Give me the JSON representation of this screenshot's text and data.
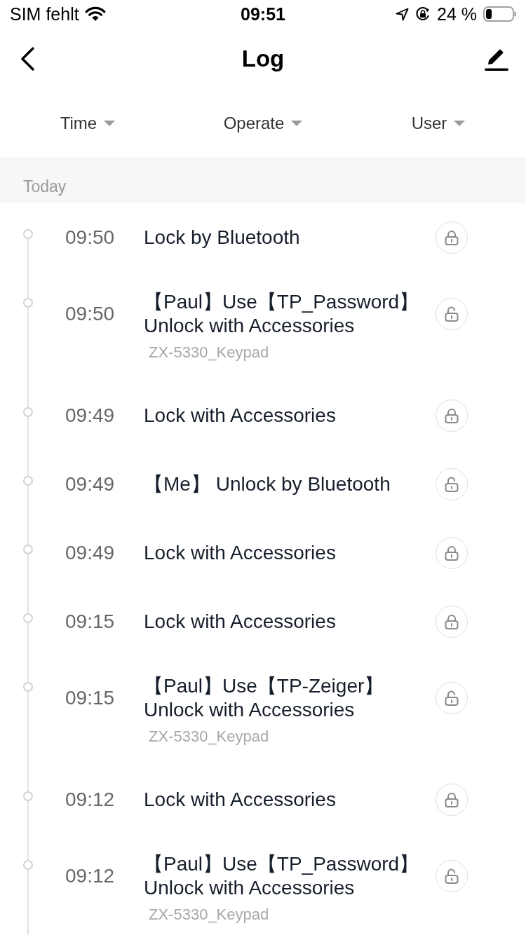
{
  "status_bar": {
    "carrier": "SIM fehlt",
    "time": "09:51",
    "battery_percent": "24 %"
  },
  "nav": {
    "title": "Log"
  },
  "filters": [
    {
      "label": "Time"
    },
    {
      "label": "Operate"
    },
    {
      "label": "User"
    }
  ],
  "sections": [
    {
      "title": "Today",
      "entries": [
        {
          "time": "09:50",
          "text": "Lock by Bluetooth",
          "locked": true
        },
        {
          "time": "09:50",
          "text": "【Paul】Use【TP_Password】Unlock with Accessories",
          "device": "ZX-5330_Keypad",
          "locked": false
        },
        {
          "time": "09:49",
          "text": "Lock with Accessories",
          "locked": true
        },
        {
          "time": "09:49",
          "text": "【Me】 Unlock by Bluetooth",
          "locked": false
        },
        {
          "time": "09:49",
          "text": "Lock with Accessories",
          "locked": true
        },
        {
          "time": "09:15",
          "text": "Lock with Accessories",
          "locked": true
        },
        {
          "time": "09:15",
          "text": "【Paul】Use【TP-Zeiger】Unlock with Accessories",
          "device": "ZX-5330_Keypad",
          "locked": false
        },
        {
          "time": "09:12",
          "text": "Lock with Accessories",
          "locked": true
        },
        {
          "time": "09:12",
          "text": "【Paul】Use【TP_Password】Unlock with Accessories",
          "device": "ZX-5330_Keypad",
          "locked": false
        }
      ]
    }
  ]
}
